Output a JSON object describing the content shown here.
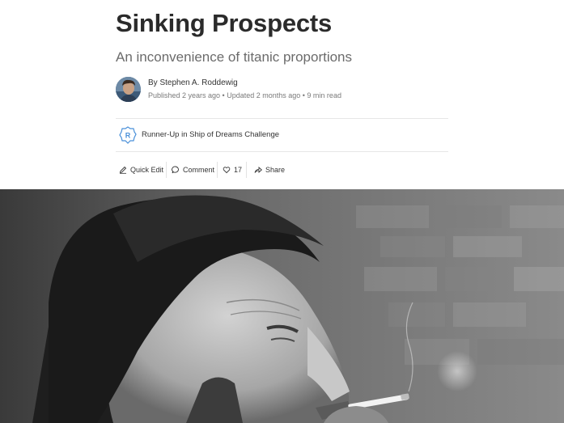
{
  "article": {
    "title": "Sinking Prospects",
    "subtitle": "An inconvenience of titanic proportions",
    "author": "By Stephen A. Roddewig",
    "meta": "Published 2 years ago • Updated 2 months ago • 9 min read"
  },
  "badge": {
    "letter": "R",
    "text": "Runner-Up in Ship of Dreams Challenge",
    "color": "#4a90d9"
  },
  "actions": {
    "quick_edit": "Quick Edit",
    "comment": "Comment",
    "like_count": "17",
    "share": "Share"
  },
  "icons": [
    "pencil-icon",
    "comment-icon",
    "heart-icon",
    "share-icon",
    "author-avatar",
    "runner-up-badge-icon"
  ],
  "colors": {
    "title": "#2b2b2b",
    "subtitle": "#6b6b6b",
    "meta": "#7a7a7a",
    "divider": "#e6e6e6"
  }
}
